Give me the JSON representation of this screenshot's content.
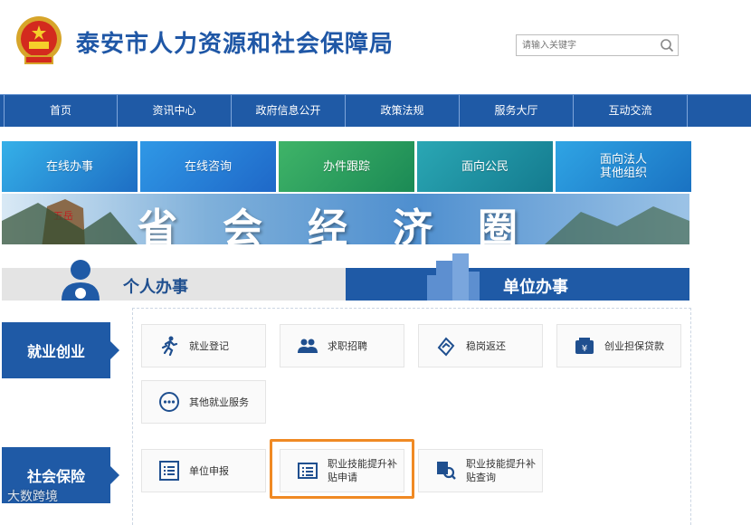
{
  "header": {
    "title": "泰安市人力资源和社会保障局",
    "search_placeholder": "请输入关键字"
  },
  "nav": [
    "首页",
    "资讯中心",
    "政府信息公开",
    "政策法规",
    "服务大厅",
    "互动交流"
  ],
  "tiles": [
    "在线办事",
    "在线咨询",
    "办件跟踪",
    "面向公民",
    "面向法人\n其他组织"
  ],
  "banner": {
    "text": "省会经济圈",
    "rock_text": "五岳"
  },
  "tabs": {
    "personal": "个人办事",
    "company": "单位办事"
  },
  "sections": {
    "employment": {
      "label": "就业创业",
      "items": [
        "就业登记",
        "求职招聘",
        "稳岗返还",
        "创业担保贷款",
        "其他就业服务"
      ]
    },
    "social_insurance": {
      "label": "社会保险",
      "items": [
        "单位申报",
        "职业技能提升补贴申请",
        "职业技能提升补贴查询"
      ]
    }
  },
  "watermark": "大数跨境",
  "colors": {
    "brand_blue": "#1f5aa6",
    "highlight": "#f08a24"
  }
}
